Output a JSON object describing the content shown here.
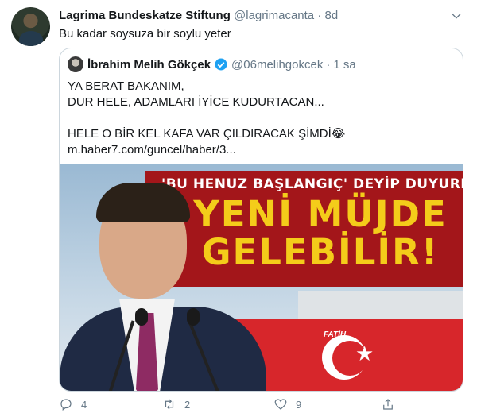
{
  "tweet": {
    "author_name": "Lagrima Bundeskatze Stiftung",
    "author_handle": "@lagrimacanta",
    "separator": "·",
    "time": "8d",
    "text": "Bu kadar soysuza bir soylu yeter"
  },
  "quoted_tweet": {
    "author_name": "İbrahim Melih Gökçek",
    "author_handle": "@06melihgokcek",
    "separator": "·",
    "time": "1 sa",
    "lines": [
      "YA BERAT BAKANIM,",
      "DUR HELE, ADAMLARI İYİCE KUDURTACAN...",
      "",
      "HELE O BİR KEL KAFA VAR ÇILDIRACAK ŞİMDİ😂",
      "m.haber7.com/guncel/haber/3..."
    ],
    "image": {
      "headline_small": "'BU HENUZ BAŞLANGIÇ' DEYİP DUYURDU",
      "headline_line1": "YENİ MÜJDE",
      "headline_line2": "GELEBİLİR!",
      "ship_name": "FATİH"
    }
  },
  "actions": {
    "reply_count": "4",
    "retweet_count": "2",
    "like_count": "9"
  },
  "icons": [
    "chevron-down-icon",
    "verified-icon",
    "reply-icon",
    "retweet-icon",
    "like-icon",
    "share-icon"
  ],
  "colors": {
    "text_primary": "#14171a",
    "text_secondary": "#657786",
    "verified_blue": "#1da1f2",
    "border": "#ccd6dd"
  }
}
